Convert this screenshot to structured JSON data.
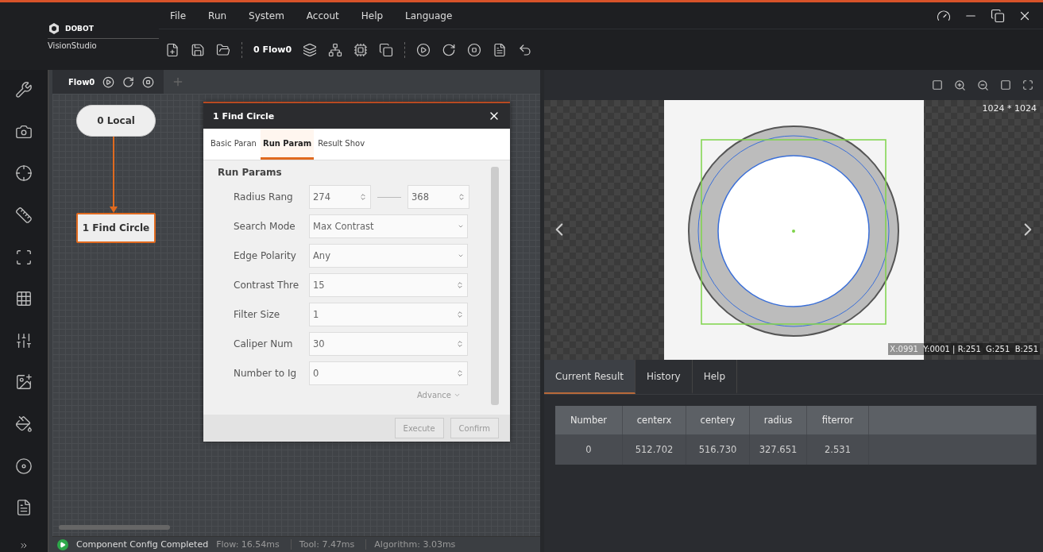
{
  "app": {
    "brand": "DOBOT",
    "product": "VisionStudio"
  },
  "menu": [
    "File",
    "Run",
    "System",
    "Accout",
    "Help",
    "Language"
  ],
  "toolbar": {
    "flow_selector": "0 Flow0"
  },
  "flow_panel": {
    "tab": "Flow0",
    "nodes": [
      {
        "label": "0 Local",
        "kind": "start",
        "selected": false
      },
      {
        "label": "1 Find Circle",
        "kind": "tool",
        "selected": true
      }
    ]
  },
  "dialog": {
    "title": "1 Find Circle",
    "tabs": [
      {
        "label": "Basic Paran",
        "selected": false
      },
      {
        "label": "Run Param",
        "selected": true
      },
      {
        "label": "Result Shov",
        "selected": false
      }
    ],
    "section": "Run Params",
    "params": [
      {
        "kind": "range",
        "label": "Radius Rang",
        "values": [
          "274",
          "368"
        ]
      },
      {
        "kind": "dropdown",
        "label": "Search Mode",
        "value": "Max Contrast"
      },
      {
        "kind": "dropdown",
        "label": "Edge Polarity",
        "value": "Any"
      },
      {
        "kind": "spin",
        "label": "Contrast Thre",
        "value": "15"
      },
      {
        "kind": "spin",
        "label": "Filter Size",
        "value": "1"
      },
      {
        "kind": "spin",
        "label": "Caliper Num",
        "value": "30"
      },
      {
        "kind": "spin",
        "label": "Number to Ig",
        "value": "0"
      }
    ],
    "advance": "Advance",
    "buttons": [
      "Execute",
      "Confirm"
    ]
  },
  "image_view": {
    "size": "1024 * 1024",
    "pixel_info": "X:0991  Y:0001 | R:251  G:251  B:251"
  },
  "results": {
    "tabs": [
      {
        "label": "Current Result",
        "selected": true
      },
      {
        "label": "History",
        "selected": false
      },
      {
        "label": "Help",
        "selected": false
      }
    ],
    "columns": [
      "Number",
      "centerx",
      "centery",
      "radius",
      "fiterror"
    ],
    "rows": [
      [
        "0",
        "512.702",
        "516.730",
        "327.651",
        "2.531"
      ]
    ]
  },
  "status_bar": {
    "message": "Component Config Completed",
    "timings": [
      "Flow: 16.54ms",
      "Tool: 7.47ms",
      "Algorithm: 3.03ms"
    ]
  }
}
